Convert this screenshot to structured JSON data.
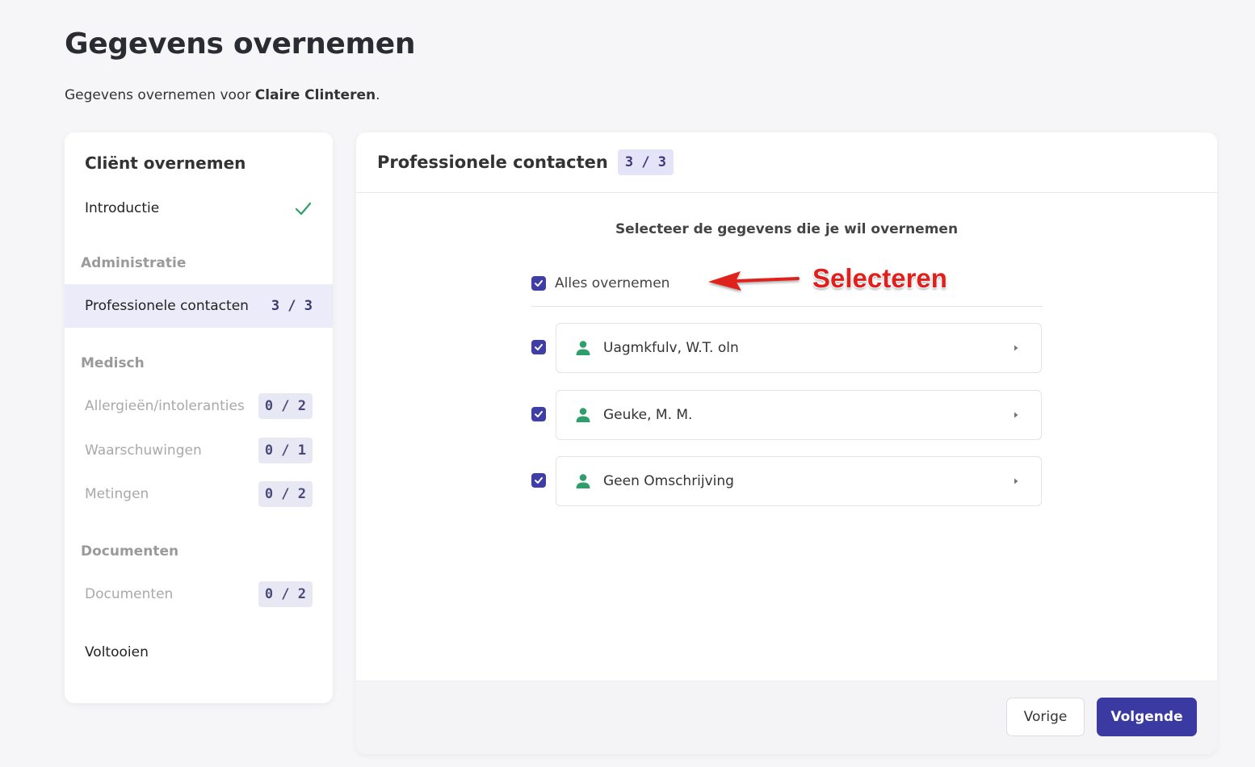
{
  "page": {
    "title": "Gegevens overnemen",
    "subtitle_prefix": "Gegevens overnemen voor",
    "client_name": "Claire Clinteren",
    "subtitle_suffix": "."
  },
  "sidebar": {
    "heading": "Cliënt overnemen",
    "intro": {
      "label": "Introductie",
      "icon": "check-icon",
      "status_color": "#2e9e6a"
    },
    "sections": {
      "administratie": "Administratie",
      "medisch": "Medisch",
      "documenten": "Documenten"
    },
    "items": {
      "professionele_contacten": {
        "label": "Professionele contacten",
        "count": "3 / 3"
      },
      "allergieen": {
        "label": "Allergieën/intoleranties",
        "count": "0 / 2"
      },
      "waarschuwingen": {
        "label": "Waarschuwingen",
        "count": "0 / 1"
      },
      "metingen": {
        "label": "Metingen",
        "count": "0 / 2"
      },
      "documenten": {
        "label": "Documenten",
        "count": "0 / 2"
      },
      "voltooien": {
        "label": "Voltooien"
      }
    }
  },
  "main": {
    "title": "Professionele contacten",
    "badge": "3 / 3",
    "instruction": "Selecteer de gegevens die je wil overnemen",
    "select_all_label": "Alles overnemen",
    "select_all_checked": true,
    "annotation": "Selecteren",
    "contacts": [
      {
        "name": "Uagmkfulv, W.T. oln",
        "checked": true,
        "icon": "person-icon"
      },
      {
        "name": "Geuke, M. M.",
        "checked": true,
        "icon": "person-icon"
      },
      {
        "name": "Geen Omschrijving",
        "checked": true,
        "icon": "person-icon"
      }
    ]
  },
  "footer": {
    "prev_label": "Vorige",
    "next_label": "Volgende"
  },
  "colors": {
    "accent": "#3b3aa2",
    "active_bg": "#ecebfa",
    "person_icon": "#2e9e6a",
    "annotation": "#e0201c"
  }
}
